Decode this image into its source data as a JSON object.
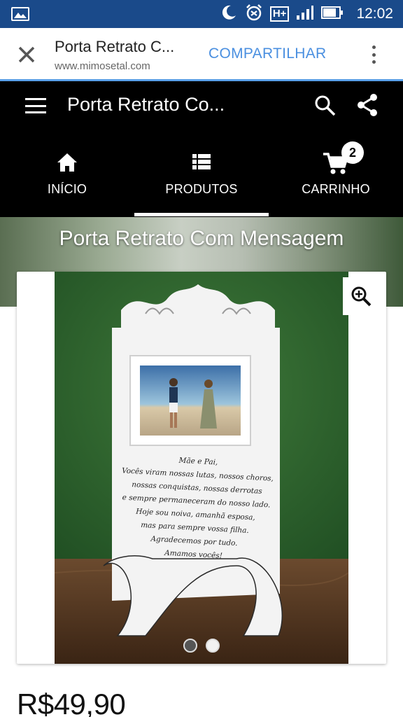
{
  "status_bar": {
    "time": "12:02",
    "network_label": "H+",
    "icons": [
      "gallery-icon",
      "moon-icon",
      "alarm-icon",
      "signal-icon",
      "battery-icon"
    ]
  },
  "browser_tab": {
    "title": "Porta Retrato C...",
    "url": "www.mimosetal.com",
    "share_label": "COMPARTILHAR"
  },
  "site_header": {
    "title": "Porta Retrato Co...",
    "nav": [
      {
        "label": "INÍCIO",
        "icon": "home-icon"
      },
      {
        "label": "PRODUTOS",
        "icon": "list-icon",
        "active": true
      },
      {
        "label": "CARRINHO",
        "icon": "cart-icon",
        "badge": "2"
      }
    ]
  },
  "banner": {
    "title": "Porta Retrato Com Mensagem"
  },
  "product": {
    "frame_text": [
      "Mãe e Pai,",
      "Vocês viram nossas lutas, nossos choros,",
      "nossas conquistas, nossas derrotas",
      "e sempre permaneceram do nosso lado.",
      "Hoje sou noiva, amanhã esposa,",
      "mas para sempre vossa filha.",
      "Agradecemos por tudo.",
      "Amamos vocês!"
    ],
    "carousel_total": 2,
    "carousel_active": 1,
    "price": "R$49,90"
  },
  "colors": {
    "status_bar": "#1a4a8a",
    "accent_link": "#4a8fe0",
    "header_bg": "#000000"
  }
}
